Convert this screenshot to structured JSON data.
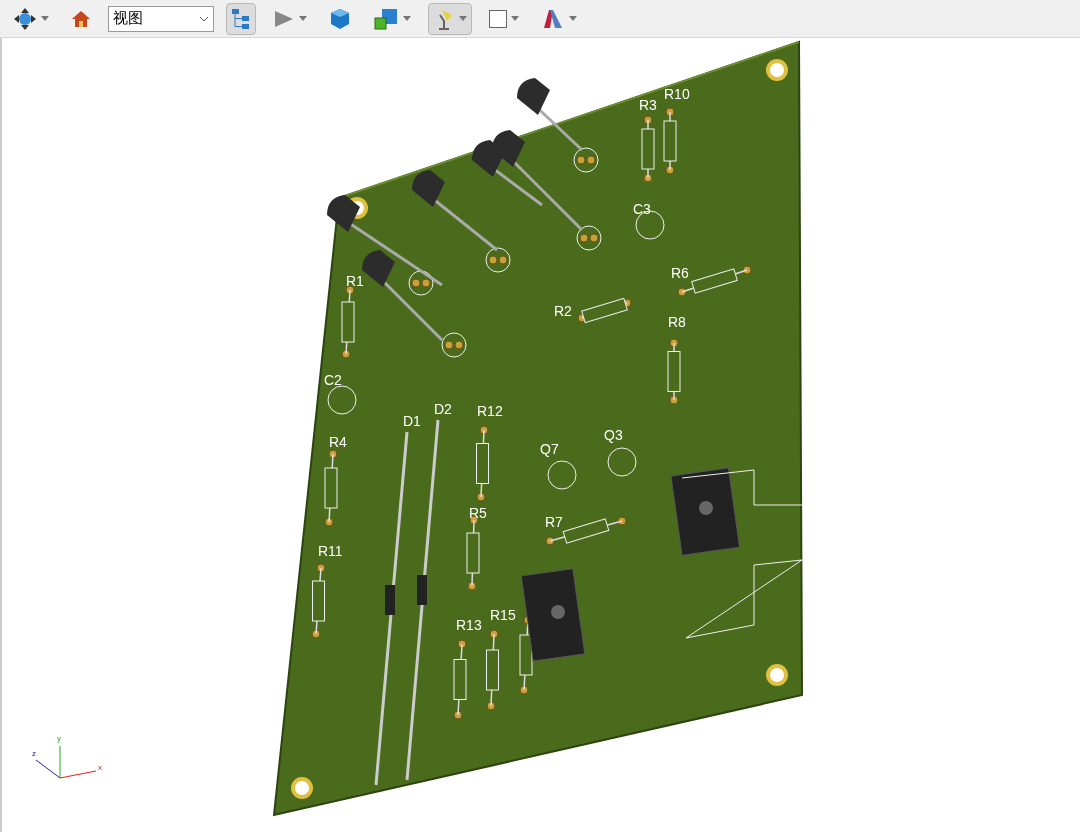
{
  "toolbar": {
    "buttons": [
      {
        "kind": "navigate",
        "pressed": false,
        "caret": true
      },
      {
        "kind": "home",
        "pressed": false,
        "caret": false
      },
      {
        "kind": "dropdown",
        "value": "视图"
      },
      {
        "kind": "tree",
        "pressed": true,
        "caret": false
      },
      {
        "kind": "play",
        "pressed": false,
        "caret": true
      },
      {
        "kind": "cube",
        "pressed": false,
        "caret": false
      },
      {
        "kind": "cubes",
        "pressed": false,
        "caret": true
      },
      {
        "kind": "lamp",
        "pressed": true,
        "caret": true
      },
      {
        "kind": "color",
        "pressed": false,
        "caret": true
      },
      {
        "kind": "faces",
        "pressed": false,
        "caret": true
      }
    ]
  },
  "viewport": {
    "labels": [
      "R3",
      "R10",
      "C3",
      "R6",
      "R2",
      "R8",
      "R1",
      "C2",
      "R4",
      "D1",
      "D2",
      "R12",
      "Q7",
      "Q3",
      "R5",
      "R7",
      "R11",
      "R13",
      "R15"
    ],
    "axes": {
      "x": "x",
      "y": "y",
      "z": "z"
    }
  }
}
